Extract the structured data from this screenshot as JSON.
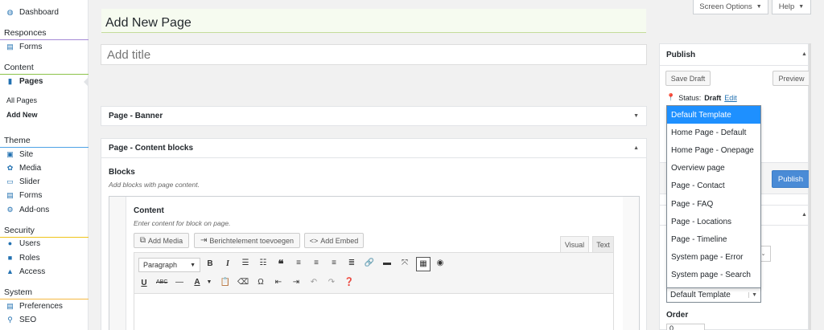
{
  "sidebar": {
    "dashboard": "Dashboard",
    "sections": [
      {
        "title": "Responces",
        "color": "#a58ad6",
        "items": [
          "Forms"
        ]
      },
      {
        "title": "Content",
        "color": "#8bc34a",
        "items": [
          "Pages"
        ],
        "subitems": [
          "All Pages",
          "Add New"
        ]
      },
      {
        "title": "Theme",
        "color": "#4ea3e6",
        "items": [
          "Site",
          "Media",
          "Slider",
          "Forms",
          "Add-ons"
        ]
      },
      {
        "title": "Security",
        "color": "#f0c419",
        "items": [
          "Users",
          "Roles",
          "Access"
        ]
      },
      {
        "title": "System",
        "color": "#f5b942",
        "items": [
          "Preferences",
          "SEO"
        ]
      }
    ]
  },
  "header": {
    "title": "Add New Page",
    "screen_options": "Screen Options",
    "help": "Help"
  },
  "editor": {
    "title_placeholder": "Add title",
    "banner_panel": "Page - Banner",
    "content_blocks_panel": "Page - Content blocks",
    "blocks_label": "Blocks",
    "blocks_hint": "Add blocks with page content.",
    "content_label": "Content",
    "content_hint": "Enter content for block on page.",
    "add_media": "Add Media",
    "add_embed_msg": "Berichtelement toevoegen",
    "add_embed": "Add Embed",
    "tab_visual": "Visual",
    "tab_text": "Text",
    "format_select": "Paragraph"
  },
  "publish": {
    "title": "Publish",
    "save_draft": "Save Draft",
    "preview": "Preview",
    "status_label": "Status:",
    "status_value": "Draft",
    "status_edit": "Edit",
    "publish_button": "Publish"
  },
  "attributes": {
    "template_select": "Default Template",
    "order_label": "Order",
    "order_value": "0"
  },
  "template_dropdown": {
    "options": [
      "Default Template",
      "Home Page - Default",
      "Home Page - Onepage",
      "Overview page",
      "Page - Contact",
      "Page - FAQ",
      "Page - Locations",
      "Page - Timeline",
      "System page - Error",
      "System page - Search"
    ],
    "selected": "Default Template"
  },
  "colors": {
    "accent": "#2271b1",
    "publish": "#4a8bd6",
    "dropdown_highlight": "#1e90ff"
  }
}
